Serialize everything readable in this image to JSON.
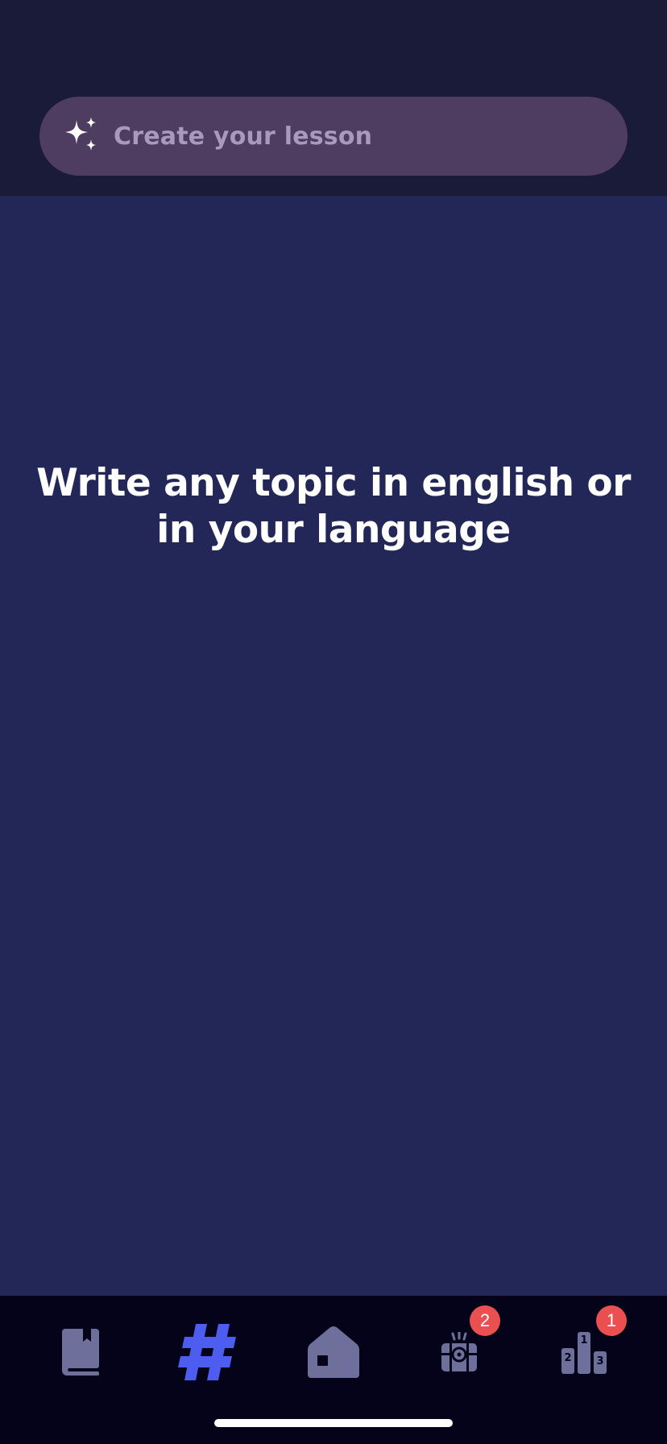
{
  "search": {
    "placeholder": "Create your lesson",
    "icon": "sparkles-icon"
  },
  "main": {
    "prompt": "Write any topic in english or in your language"
  },
  "tabbar": {
    "items": [
      {
        "name": "library",
        "icon": "book-icon",
        "active": false
      },
      {
        "name": "topics",
        "icon": "hashtag-icon",
        "active": true
      },
      {
        "name": "home",
        "icon": "home-icon",
        "active": false
      },
      {
        "name": "rewards",
        "icon": "treasure-chest-icon",
        "active": false,
        "badge": "2"
      },
      {
        "name": "leaderboard",
        "icon": "podium-icon",
        "active": false,
        "badge": "1"
      }
    ]
  },
  "colors": {
    "header_bg": "#191b38",
    "main_bg": "#222758",
    "search_bg": "#4f3c61",
    "tab_inactive": "#6e6f9b",
    "tab_active": "#4c5df0",
    "badge": "#e9504f",
    "tabbar_bg": "#04031a"
  }
}
